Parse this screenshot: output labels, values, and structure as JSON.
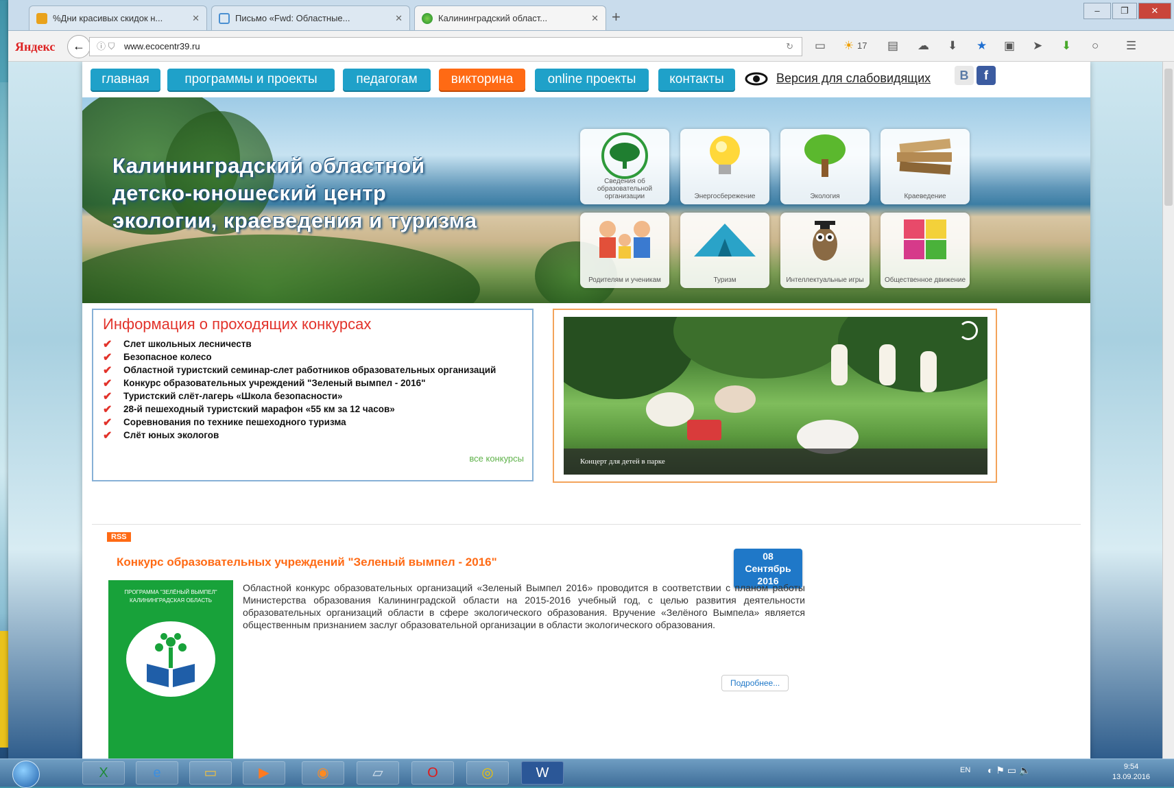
{
  "browser": {
    "tabs": [
      {
        "label": "%Дни красивых скидок н...",
        "color": "#e9a21c"
      },
      {
        "label": "Письмо «Fwd: Областные...",
        "color": "#4a8fd1"
      },
      {
        "label": "Калининградский област...",
        "color": "#2a9b3a"
      }
    ],
    "brand": "Яндекс",
    "url": "www.ecocentr39.ru",
    "weather": "17"
  },
  "site": {
    "menu": [
      "главная",
      "программы и проекты",
      "педагогам",
      "викторина",
      "online проекты",
      "контакты"
    ],
    "accessibility_link": "Версия для слабовидящих",
    "social": [
      "В",
      "f"
    ],
    "banner": {
      "title_lines": [
        "Калининградский областной",
        "детско-юношеский центр",
        "экологии, краеведения и туризма"
      ],
      "tiles": [
        {
          "caption": "Сведения об образовательной организации",
          "icon": "tree-logo-icon"
        },
        {
          "caption": "Энергосбережение",
          "icon": "lightbulb-icon"
        },
        {
          "caption": "Экология",
          "icon": "tree-icon"
        },
        {
          "caption": "Краеведение",
          "icon": "books-icon"
        },
        {
          "caption": "Родителям и ученикам",
          "icon": "family-icon"
        },
        {
          "caption": "Туризм",
          "icon": "tent-icon"
        },
        {
          "caption": "Интеллектуальные игры",
          "icon": "owl-icon"
        },
        {
          "caption": "Общественное движение",
          "icon": "puzzle-icon"
        }
      ]
    },
    "contests": {
      "heading": "Информация о проходящих конкурсах",
      "items": [
        "Слет школьных лесничеств",
        "Безопасное колесо",
        "Областной туристский семинар-слет работников образовательных организаций",
        "Конкурс образовательных учреждений \"Зеленый вымпел - 2016\"",
        "Туристский слёт-лагерь «Школа безопасности»",
        "28-й пешеходный туристский марафон «55 км за 12 часов»",
        "Соревнования по технике пешеходного туризма",
        "Слёт юных экологов"
      ],
      "all_link": "все конкурсы"
    },
    "slider": {
      "caption": "Концерт для детей в парке"
    },
    "rss": "RSS",
    "news": {
      "title": "Конкурс образовательных учреждений \"Зеленый вымпел - 2016\"",
      "date": {
        "day": "08",
        "month": "Сентябрь",
        "year": "2016"
      },
      "image_text": "ПРОГРАММА \"ЗЕЛЁНЫЙ ВЫМПЕЛ\" КАЛИНИНГРАДСКАЯ ОБЛАСТЬ",
      "body": "Областной конкурс образовательных организаций «Зеленый Вымпел 2016» проводится в соответствии с планом работы Министерства образования Калининградской области на 2015-2016 учебный год, с целью развития деятельности образовательных организаций области в сфере экологического образования. Вручение «Зелёного Вымпела» является общественным признанием заслуг образовательной организации в области экологического образования.",
      "more": "Подробнее..."
    }
  },
  "taskbar": {
    "lang": "EN",
    "time": "9:54",
    "date": "13.09.2016"
  }
}
